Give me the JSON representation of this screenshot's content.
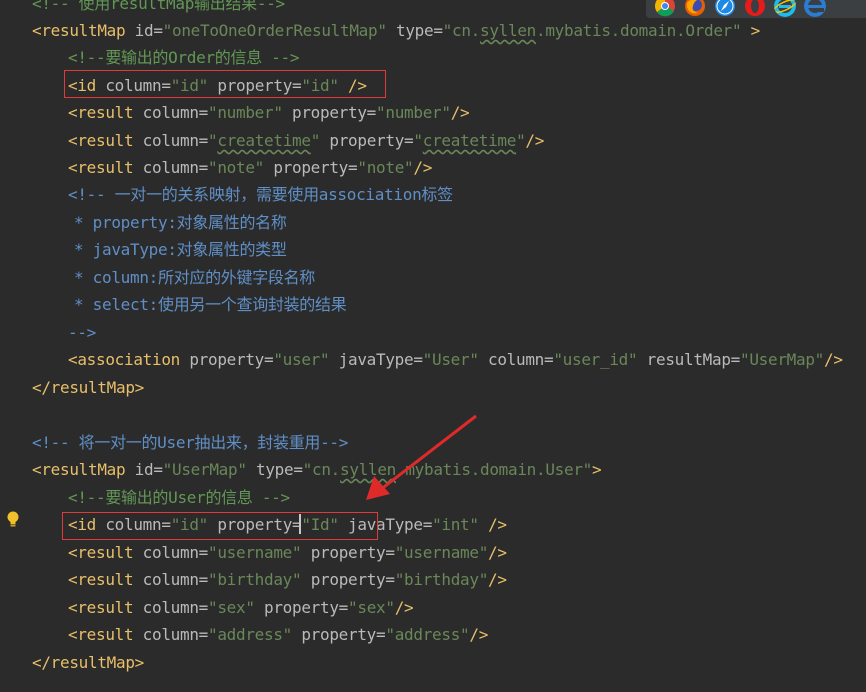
{
  "lines": [
    {
      "id": "l0",
      "parts": [
        [
          "cmt",
          "<!-- 使用resultMap输出结果-->"
        ]
      ]
    },
    {
      "id": "l1",
      "parts": [
        [
          "tag",
          "<resultMap "
        ],
        [
          "attr",
          "id="
        ],
        [
          "val",
          "\"oneToOneOrderResultMap\""
        ],
        [
          "attr",
          " type="
        ],
        [
          "val",
          "\"cn."
        ],
        [
          "valw",
          "syllen"
        ],
        [
          "val",
          ".mybatis.domain.Order\""
        ],
        [
          "tag",
          " >"
        ]
      ]
    },
    {
      "id": "l2",
      "parts": [
        [
          "cmt",
          "<!--要输出的Order的信息 -->"
        ]
      ]
    },
    {
      "id": "l3",
      "parts": [
        [
          "tag",
          "<id "
        ],
        [
          "attr",
          "column="
        ],
        [
          "val",
          "\"id\""
        ],
        [
          "attr",
          " property="
        ],
        [
          "val",
          "\"id\""
        ],
        [
          "tag",
          " />"
        ]
      ]
    },
    {
      "id": "l4",
      "parts": [
        [
          "tag",
          "<result "
        ],
        [
          "attr",
          "column="
        ],
        [
          "val",
          "\"number\""
        ],
        [
          "attr",
          " property="
        ],
        [
          "val",
          "\"number\""
        ],
        [
          "tag",
          "/>"
        ]
      ]
    },
    {
      "id": "l5",
      "parts": [
        [
          "tag",
          "<result "
        ],
        [
          "attr",
          "column="
        ],
        [
          "val",
          "\""
        ],
        [
          "valw",
          "createtime"
        ],
        [
          "val",
          "\""
        ],
        [
          "attr",
          " property="
        ],
        [
          "val",
          "\""
        ],
        [
          "valw",
          "createtime"
        ],
        [
          "val",
          "\""
        ],
        [
          "tag",
          "/>"
        ]
      ]
    },
    {
      "id": "l6",
      "parts": [
        [
          "tag",
          "<result "
        ],
        [
          "attr",
          "column="
        ],
        [
          "val",
          "\"note\""
        ],
        [
          "attr",
          " property="
        ],
        [
          "val",
          "\"note\""
        ],
        [
          "tag",
          "/>"
        ]
      ]
    },
    {
      "id": "l7",
      "parts": [
        [
          "cmtb",
          "<!-- 一对一的关系映射，需要使用association标签"
        ]
      ]
    },
    {
      "id": "l8",
      "parts": [
        [
          "cmtb",
          "* property:对象属性的名称"
        ]
      ]
    },
    {
      "id": "l9",
      "parts": [
        [
          "cmtb",
          "* javaType:对象属性的类型"
        ]
      ]
    },
    {
      "id": "l10",
      "parts": [
        [
          "cmtb",
          "* column:所对应的外键字段名称"
        ]
      ]
    },
    {
      "id": "l11",
      "parts": [
        [
          "cmtb",
          "* select:使用另一个查询封装的结果"
        ]
      ]
    },
    {
      "id": "l12",
      "parts": [
        [
          "cmtb",
          "-->"
        ]
      ]
    },
    {
      "id": "l13",
      "parts": [
        [
          "tag",
          "<association "
        ],
        [
          "attr",
          "property="
        ],
        [
          "val",
          "\"user\""
        ],
        [
          "attr",
          " javaType="
        ],
        [
          "val",
          "\"User\""
        ],
        [
          "attr",
          " column="
        ],
        [
          "val",
          "\"user_id\""
        ],
        [
          "attr",
          " resultMap="
        ],
        [
          "val",
          "\"UserMap\""
        ],
        [
          "tag",
          "/>"
        ]
      ]
    },
    {
      "id": "l14",
      "parts": [
        [
          "tag",
          "</resultMap>"
        ]
      ]
    },
    {
      "id": "l15",
      "parts": []
    },
    {
      "id": "l16",
      "parts": [
        [
          "cmtb",
          "<!-- 将一对一的User抽出来，封装重用-->"
        ]
      ]
    },
    {
      "id": "l17",
      "parts": [
        [
          "tag",
          "<resultMap "
        ],
        [
          "attr",
          "id="
        ],
        [
          "val",
          "\"UserMap\""
        ],
        [
          "attr",
          " type="
        ],
        [
          "val",
          "\"cn."
        ],
        [
          "valw",
          "syllen"
        ],
        [
          "val",
          ".mybatis.domain.User\""
        ],
        [
          "tag",
          ">"
        ]
      ]
    },
    {
      "id": "l18",
      "parts": [
        [
          "cmt",
          "<!--要输出的User的信息 -->"
        ]
      ]
    },
    {
      "id": "l19",
      "parts": [
        [
          "tag",
          "<id "
        ],
        [
          "attr",
          "column="
        ],
        [
          "val",
          "\"id\""
        ],
        [
          "attr",
          " property="
        ],
        [
          "val",
          "\"Id\""
        ],
        [
          "attr",
          " javaType="
        ],
        [
          "val",
          "\"int\""
        ],
        [
          "tag",
          " />"
        ]
      ]
    },
    {
      "id": "l20",
      "parts": [
        [
          "tag",
          "<result "
        ],
        [
          "attr",
          "column="
        ],
        [
          "val",
          "\"username\""
        ],
        [
          "attr",
          " property="
        ],
        [
          "val",
          "\"username\""
        ],
        [
          "tag",
          "/>"
        ]
      ]
    },
    {
      "id": "l21",
      "parts": [
        [
          "tag",
          "<result "
        ],
        [
          "attr",
          "column="
        ],
        [
          "val",
          "\"birthday\""
        ],
        [
          "attr",
          " property="
        ],
        [
          "val",
          "\"birthday\""
        ],
        [
          "tag",
          "/>"
        ]
      ]
    },
    {
      "id": "l22",
      "parts": [
        [
          "tag",
          "<result "
        ],
        [
          "attr",
          "column="
        ],
        [
          "val",
          "\"sex\""
        ],
        [
          "attr",
          " property="
        ],
        [
          "val",
          "\"sex\""
        ],
        [
          "tag",
          "/>"
        ]
      ]
    },
    {
      "id": "l23",
      "parts": [
        [
          "tag",
          "<result "
        ],
        [
          "attr",
          "column="
        ],
        [
          "val",
          "\"address\""
        ],
        [
          "attr",
          " property="
        ],
        [
          "val",
          "\"address\""
        ],
        [
          "tag",
          "/>"
        ]
      ]
    },
    {
      "id": "l24",
      "parts": [
        [
          "tag",
          "</resultMap>"
        ]
      ]
    }
  ],
  "browser_icons": [
    "chrome-icon",
    "firefox-icon",
    "safari-icon",
    "opera-icon",
    "ie-icon",
    "edge-icon"
  ],
  "colors": {
    "background": "#2b2b2b",
    "tag": "#e8bf6a",
    "value": "#6a8759",
    "comment": "#629755",
    "highlight": "#e03a3a"
  }
}
